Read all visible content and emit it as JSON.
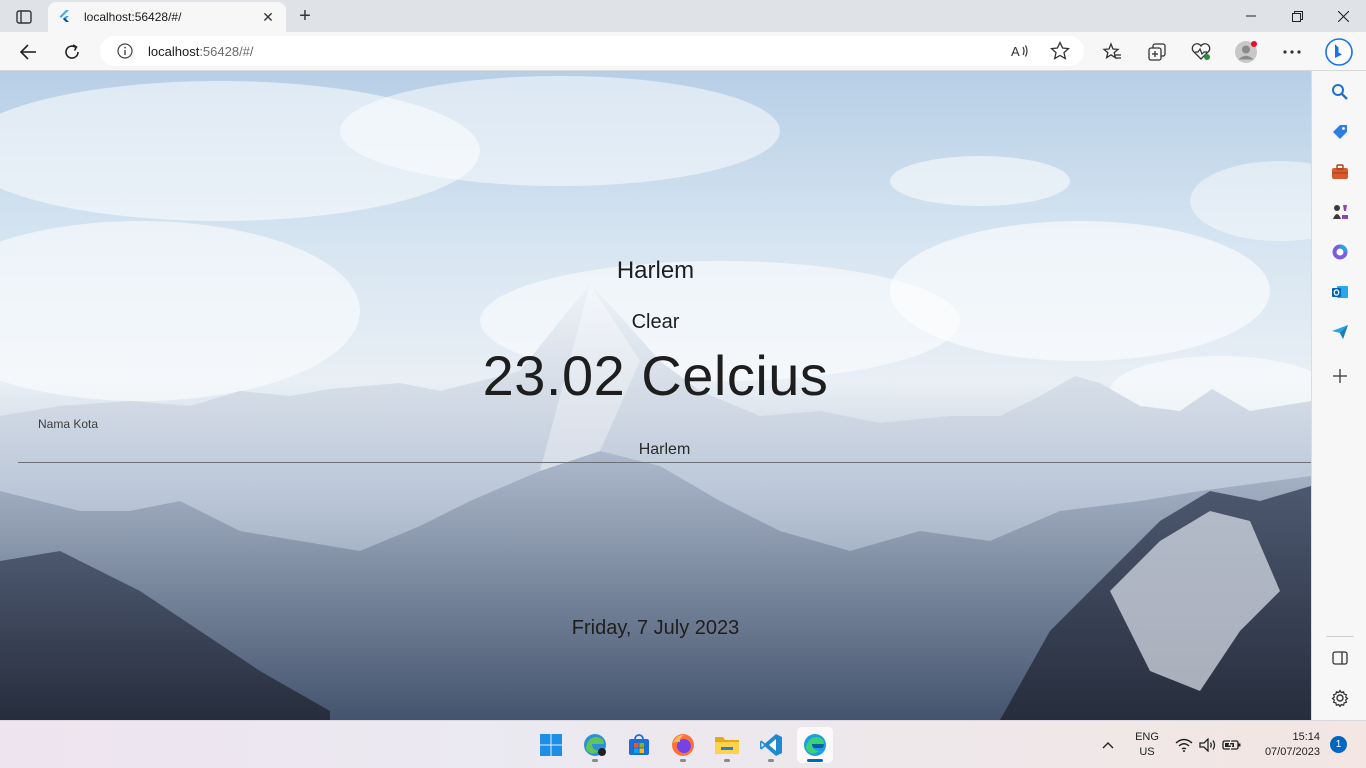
{
  "browser": {
    "tab": {
      "title": "localhost:56428/#/"
    },
    "address": {
      "host": "localhost",
      "rest": ":56428/#/"
    }
  },
  "app": {
    "city_title": "Harlem",
    "weather": "Clear",
    "temperature": "23.02 Celcius",
    "city_field": {
      "label": "Nama Kota",
      "value": "Harlem"
    },
    "date": "Friday, 7 July 2023"
  },
  "taskbar": {
    "lang_top": "ENG",
    "lang_bottom": "US",
    "time": "15:14",
    "date": "07/07/2023",
    "notifications": "1"
  },
  "colors": {
    "edge_blue": "#0067c0",
    "text_dark": "#1e1e1e"
  }
}
